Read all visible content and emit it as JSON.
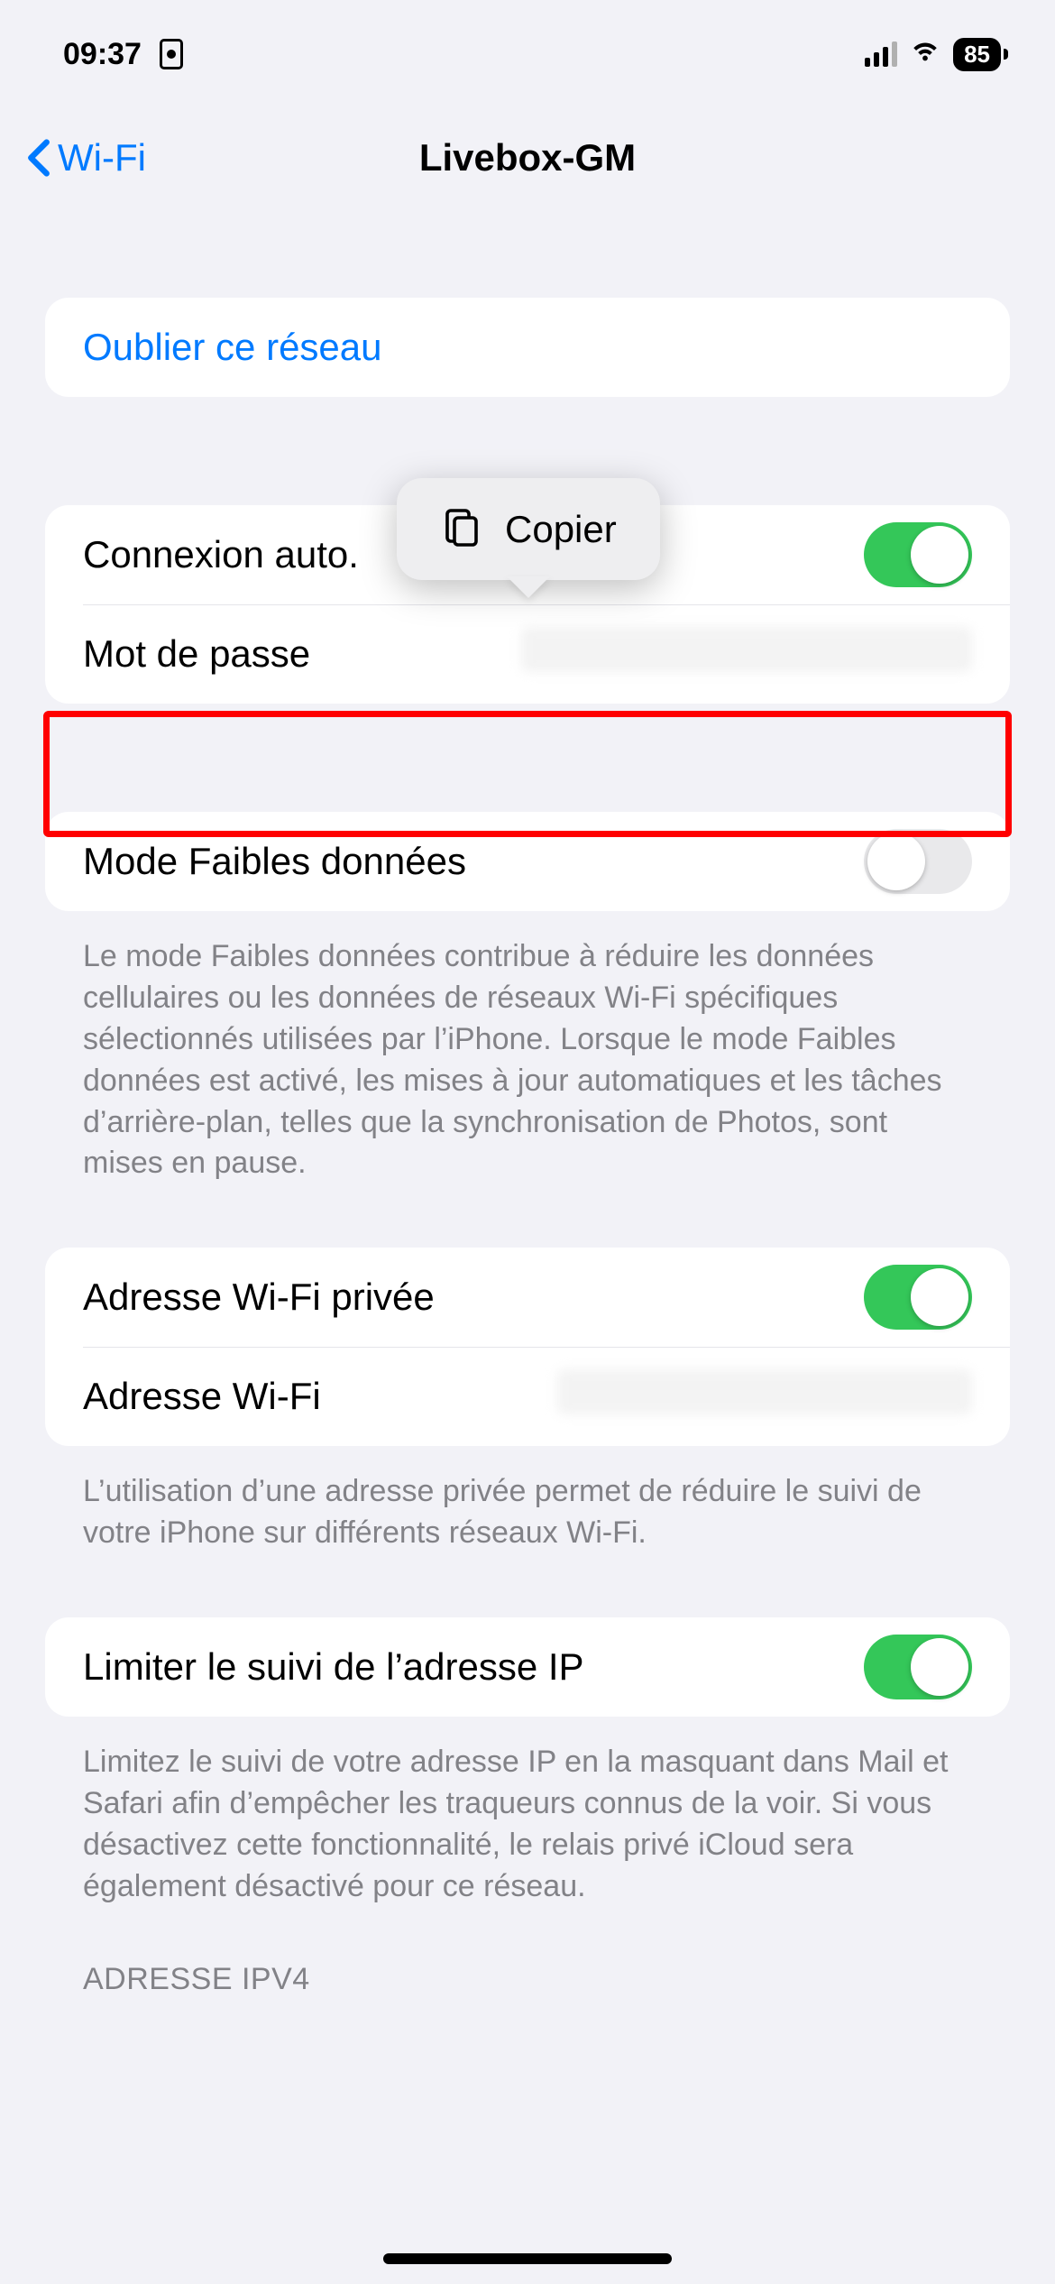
{
  "status": {
    "time": "09:37",
    "battery": "85"
  },
  "nav": {
    "back_label": "Wi-Fi",
    "title": "Livebox-GM"
  },
  "popover": {
    "copy_label": "Copier"
  },
  "forget": {
    "label": "Oublier ce réseau"
  },
  "auto_join": {
    "label": "Connexion auto.",
    "on": true
  },
  "password": {
    "label": "Mot de passe"
  },
  "low_data": {
    "label": "Mode Faibles données",
    "on": false,
    "footer": "Le mode Faibles données contribue à réduire les données cellulaires ou les données de réseaux Wi-Fi spécifiques sélectionnés utilisées par l’iPhone. Lorsque le mode Faibles données est activé, les mises à jour automatiques et les tâches d’arrière-plan, telles que la synchronisation de Photos, sont mises en pause."
  },
  "private_addr": {
    "toggle_label": "Adresse Wi-Fi privée",
    "toggle_on": true,
    "addr_label": "Adresse Wi-Fi",
    "footer": "L’utilisation d’une adresse privée permet de réduire le suivi de votre iPhone sur différents réseaux Wi-Fi."
  },
  "limit_ip": {
    "label": "Limiter le suivi de l’adresse IP",
    "on": true,
    "footer": "Limitez le suivi de votre adresse IP en la masquant dans Mail et Safari afin d’empêcher les traqueurs connus de la voir. Si vous désactivez cette fonctionnalité, le relais privé iCloud sera également désactivé pour ce réseau."
  },
  "ipv4_header": "ADRESSE IPV4"
}
